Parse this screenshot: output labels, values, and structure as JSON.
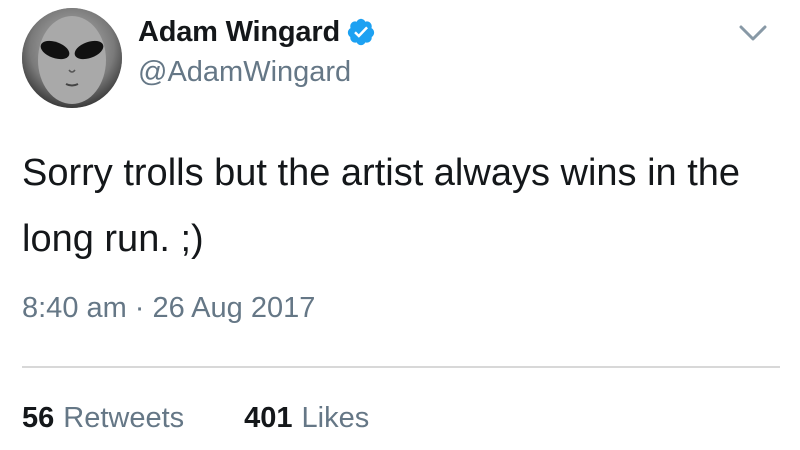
{
  "author": {
    "display_name": "Adam Wingard",
    "handle": "@AdamWingard",
    "verified": true,
    "avatar": "alien-face-avatar"
  },
  "menu": {
    "icon": "chevron-down-icon"
  },
  "tweet": {
    "text": "Sorry trolls but the artist always wins in the long run. ;)",
    "time": "8:40 am",
    "separator": "·",
    "date": "26 Aug 2017"
  },
  "stats": {
    "retweets": {
      "count": "56",
      "label": "Retweets"
    },
    "likes": {
      "count": "401",
      "label": "Likes"
    }
  },
  "colors": {
    "text_primary": "#14171a",
    "text_secondary": "#657786",
    "verified_badge": "#1da1f2",
    "divider": "#d8d8d8",
    "background": "#ffffff"
  }
}
